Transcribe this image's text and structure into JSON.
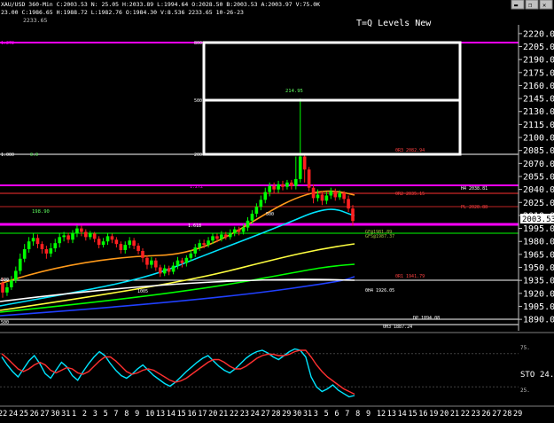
{
  "header": {
    "symbol_line": "XAU/USD  360-Min  C:2003.53  N:  25.05  H:2033.89  L:1994.64  O:2028.50  B:2003.53  A:2003.97  V:75.0K",
    "stats_line": "23.00  C:1986.65  H:1988.72  L:1982.76  O:1984.30  V:8.536  2233.65  10-26-23",
    "level_tag": "2233.65",
    "window_controls": [
      "▬",
      "❐",
      "✕"
    ]
  },
  "overlay_title": "T=Q Levels New",
  "left_labels": {
    "fib_272": "1.272",
    "fib_1000": "1.000",
    "val_19890": "198.90",
    "zero_left": "500",
    "bottom_500": "500",
    "fib_1618": "1.618",
    "mid_500": "500",
    "pct_ticker": "0.0",
    "count": "1005"
  },
  "box_labels": {
    "top": "800",
    "mid": "500",
    "bottom": "200"
  },
  "peak_label": "214.95",
  "inline_labels": {
    "r3": "0R3 2082.94",
    "r2": "0R2 2035.15",
    "r1": "0R1 2041.79",
    "h4": "H4 2038.81",
    "pl": "PL 2028.88",
    "r1b": "0R1 1941.79",
    "h4b": "0H4 1926.05",
    "dp": "DP 1894.08",
    "oh3": "0H3 1887.24",
    "small1": "GF@1981.89",
    "small2": "GFS@1987.37",
    "fib1272": "1.272",
    "fib500": "500",
    "fib1618": "1.618",
    "box500": "500"
  },
  "price_axis": {
    "ticks": [
      2220.0,
      2205.0,
      2190.0,
      2175.0,
      2160.0,
      2145.0,
      2130.0,
      2115.0,
      2100.0,
      2085.0,
      2070.0,
      2055.0,
      2040.0,
      2025.0,
      2010.0,
      1995.0,
      1980.0,
      1965.0,
      1950.0,
      1935.0,
      1920.0,
      1905.0,
      1890.0
    ],
    "current_price": "2003.53",
    "range": [
      1885,
      2226
    ]
  },
  "oscillator": {
    "label": "STO",
    "value": "24.",
    "levels": [
      "75.",
      "25."
    ]
  },
  "x_axis": {
    "labels": [
      "22",
      "24",
      "25",
      "26",
      "27",
      "30",
      "31",
      "1",
      "2",
      "3",
      "5",
      "7",
      "8",
      "9",
      "10",
      "13",
      "14",
      "15",
      "16",
      "17",
      "20",
      "21",
      "22",
      "23",
      "24",
      "27",
      "28",
      "29",
      "30",
      "31",
      "3",
      "5",
      "6",
      "7",
      "8",
      "9",
      "12",
      "13",
      "14",
      "15",
      "16",
      "19",
      "20",
      "21",
      "22",
      "23",
      "26",
      "27",
      "28",
      "29"
    ]
  },
  "colors": {
    "bg": "#000000",
    "up": "#00ff00",
    "down": "#ff2020",
    "magenta": "#ff00ff",
    "white": "#ffffff",
    "cyan": "#00e5ff",
    "yellow": "#ffff40",
    "green": "#00ff00",
    "blue": "#2040ff",
    "orange": "#ff9a1a",
    "red": "#ff3030",
    "olive": "#a0c040"
  },
  "chart_data": {
    "type": "candlestick",
    "ylim": [
      1885,
      2226
    ],
    "candles": [
      [
        1932,
        1921,
        1938,
        1915
      ],
      [
        1921,
        1927,
        1932,
        1917
      ],
      [
        1927,
        1935,
        1940,
        1924
      ],
      [
        1935,
        1946,
        1951,
        1932
      ],
      [
        1946,
        1960,
        1966,
        1942
      ],
      [
        1960,
        1971,
        1977,
        1956
      ],
      [
        1971,
        1980,
        1985,
        1967
      ],
      [
        1980,
        1984,
        1990,
        1975
      ],
      [
        1984,
        1977,
        1988,
        1972
      ],
      [
        1977,
        1971,
        1980,
        1966
      ],
      [
        1971,
        1966,
        1975,
        1960
      ],
      [
        1966,
        1972,
        1978,
        1962
      ],
      [
        1972,
        1978,
        1983,
        1968
      ],
      [
        1978,
        1985,
        1989,
        1973
      ],
      [
        1985,
        1987,
        1991,
        1980
      ],
      [
        1987,
        1982,
        1990,
        1978
      ],
      [
        1982,
        1989,
        1993,
        1978
      ],
      [
        1989,
        1995,
        1999,
        1985
      ],
      [
        1995,
        1991,
        1998,
        1986
      ],
      [
        1991,
        1985,
        1994,
        1981
      ],
      [
        1985,
        1989,
        1992,
        1982
      ],
      [
        1989,
        1983,
        1991,
        1979
      ],
      [
        1983,
        1976,
        1986,
        1972
      ],
      [
        1976,
        1980,
        1984,
        1973
      ],
      [
        1980,
        1986,
        1989,
        1976
      ],
      [
        1986,
        1982,
        1989,
        1978
      ],
      [
        1982,
        1977,
        1985,
        1973
      ],
      [
        1977,
        1970,
        1980,
        1966
      ],
      [
        1970,
        1976,
        1980,
        1966
      ],
      [
        1976,
        1981,
        1985,
        1972
      ],
      [
        1981,
        1975,
        1984,
        1971
      ],
      [
        1975,
        1969,
        1978,
        1965
      ],
      [
        1969,
        1961,
        1972,
        1956
      ],
      [
        1961,
        1953,
        1964,
        1948
      ],
      [
        1953,
        1958,
        1962,
        1949
      ],
      [
        1958,
        1950,
        1961,
        1946
      ],
      [
        1950,
        1943,
        1953,
        1939
      ],
      [
        1943,
        1949,
        1953,
        1940
      ],
      [
        1949,
        1945,
        1952,
        1941
      ],
      [
        1945,
        1952,
        1956,
        1942
      ],
      [
        1952,
        1958,
        1962,
        1948
      ],
      [
        1958,
        1955,
        1961,
        1950
      ],
      [
        1955,
        1961,
        1964,
        1951
      ],
      [
        1961,
        1966,
        1970,
        1957
      ],
      [
        1966,
        1973,
        1977,
        1962
      ],
      [
        1973,
        1978,
        1982,
        1969
      ],
      [
        1978,
        1976,
        1982,
        1972
      ],
      [
        1976,
        1981,
        1985,
        1973
      ],
      [
        1981,
        1986,
        1989,
        1977
      ],
      [
        1986,
        1983,
        1989,
        1979
      ],
      [
        1983,
        1988,
        1992,
        1980
      ],
      [
        1988,
        1985,
        1991,
        1982
      ],
      [
        1985,
        1990,
        1994,
        1982
      ],
      [
        1990,
        1994,
        1997,
        1986
      ],
      [
        1994,
        1991,
        1997,
        1987
      ],
      [
        1991,
        1996,
        2000,
        1988
      ],
      [
        1996,
        2004,
        2008,
        1992
      ],
      [
        2004,
        2012,
        2016,
        2000
      ],
      [
        2012,
        2020,
        2024,
        2008
      ],
      [
        2020,
        2028,
        2033,
        2016
      ],
      [
        2028,
        2037,
        2042,
        2024
      ],
      [
        2037,
        2044,
        2048,
        2032
      ],
      [
        2044,
        2040,
        2048,
        2035
      ],
      [
        2040,
        2046,
        2050,
        2036
      ],
      [
        2046,
        2043,
        2050,
        2039
      ],
      [
        2043,
        2048,
        2051,
        2040
      ],
      [
        2048,
        2044,
        2051,
        2040
      ],
      [
        2044,
        2052,
        2078,
        2040
      ],
      [
        2052,
        2078,
        2145,
        2048
      ],
      [
        2078,
        2063,
        2082,
        2048
      ],
      [
        2063,
        2042,
        2066,
        2038
      ],
      [
        2042,
        2030,
        2046,
        2024
      ],
      [
        2030,
        2034,
        2040,
        2026
      ],
      [
        2034,
        2027,
        2038,
        2022
      ],
      [
        2027,
        2033,
        2037,
        2023
      ],
      [
        2033,
        2038,
        2042,
        2029
      ],
      [
        2038,
        2031,
        2041,
        2027
      ],
      [
        2031,
        2036,
        2039,
        2028
      ],
      [
        2036,
        2029,
        2038,
        2024
      ],
      [
        2029,
        2018,
        2033,
        2014
      ],
      [
        2018,
        2003.53,
        2022,
        1998
      ]
    ]
  }
}
